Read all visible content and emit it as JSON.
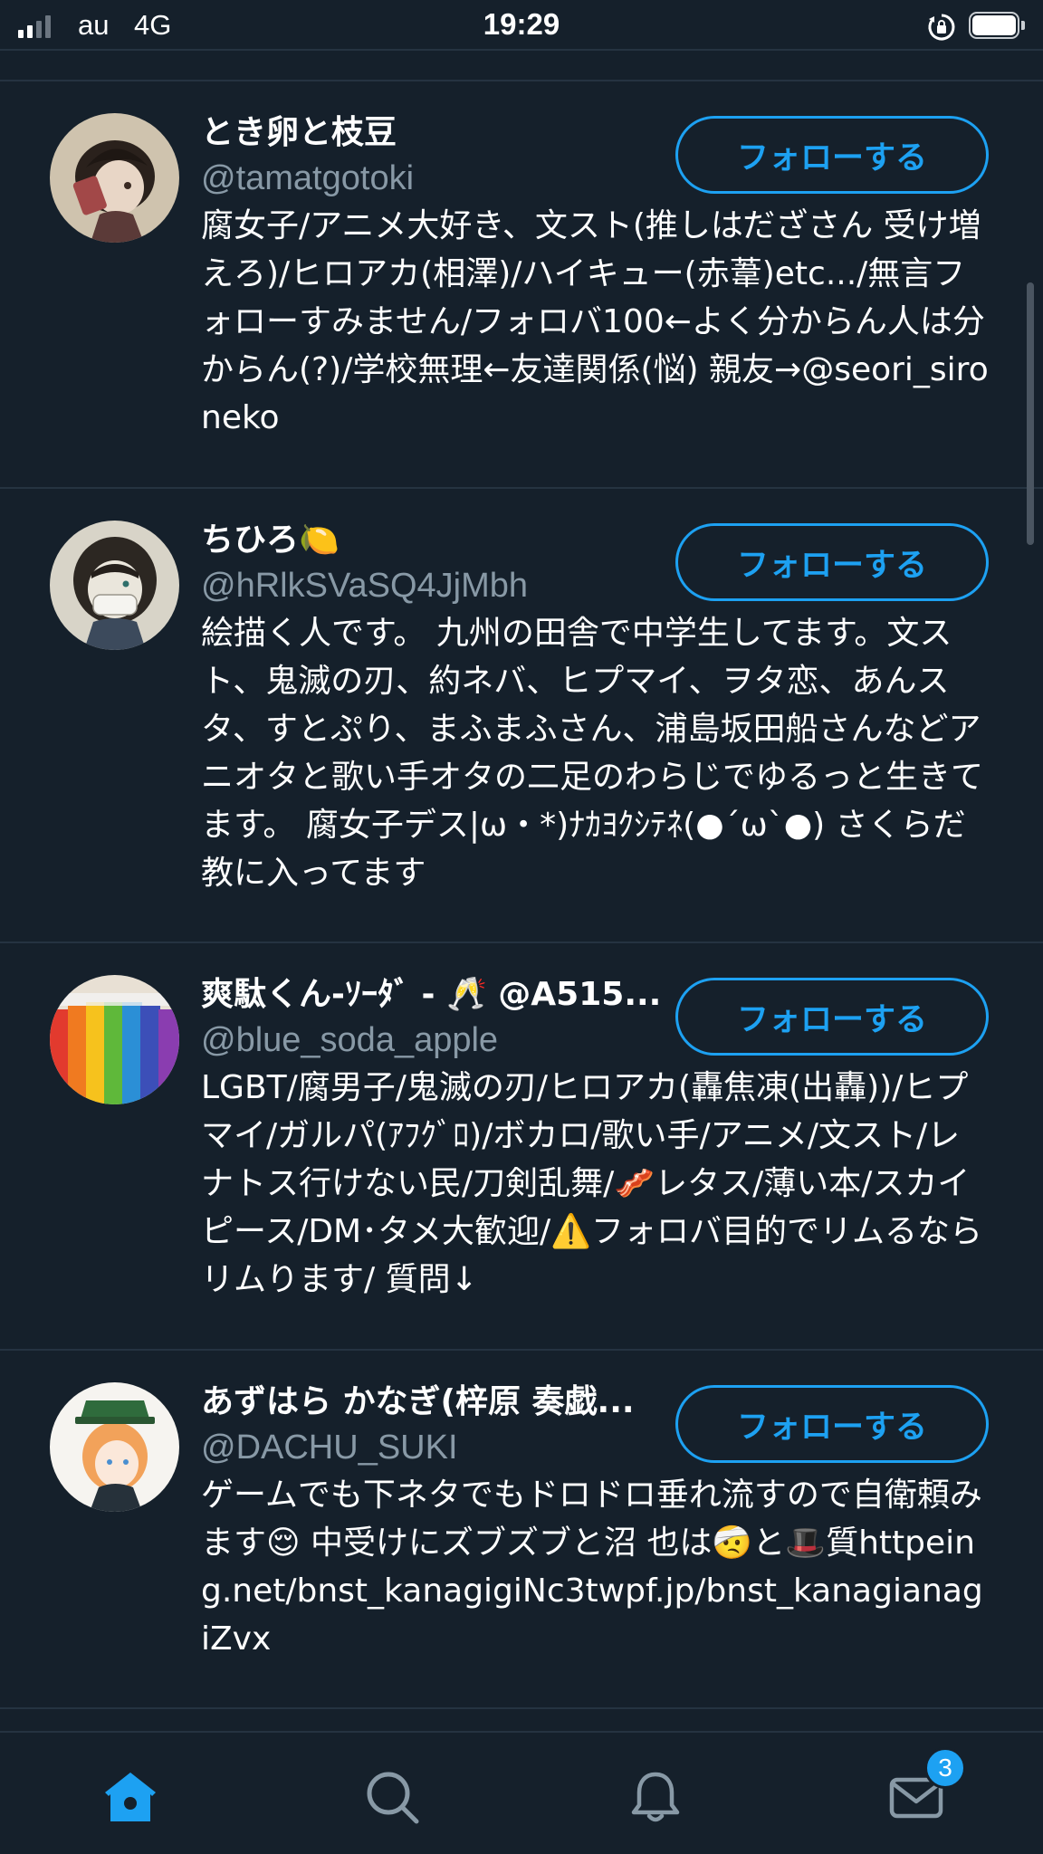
{
  "status_bar": {
    "carrier": "au",
    "network": "4G",
    "time": "19:29"
  },
  "users": [
    {
      "display_name": "とき卵と枝豆",
      "handle": "@tamatgotoki",
      "bio": "腐女子/アニメ大好き、文スト(推しはだざさん 受け増えろ)/ヒロアカ(相澤)/ハイキュー(赤葦)etc.../無言フォローすみません/フォロバ100←よく分からん人は分からん(?)/学校無理←友達関係(悩) 親友→@seori_sironeko",
      "follow_label": "フォローする"
    },
    {
      "display_name": "ちひろ🍋",
      "handle": "@hRlkSVaSQ4JjMbh",
      "bio": "絵描く人です。 九州の田舎で中学生してます。文スト、鬼滅の刃、約ネバ、ヒプマイ、ヲタ恋、あんスタ、すとぷり、まふまふさん、浦島坂田船さんなどアニオタと歌い手オタの二足のわらじでゆるっと生きてます。 腐女子デス|ω・*)ﾅｶﾖｸｼﾃﾈ(●´ω`●) さくらだ教に入ってます",
      "follow_label": "フォローする"
    },
    {
      "display_name": "爽駄くん-ｿｰﾀﾞ - 🥂 @A515...",
      "handle": "@blue_soda_apple",
      "bio": "LGBT/腐男子/鬼滅の刃/ヒロアカ(轟焦凍(出轟))/ヒプマイ/ガルパ(ｱﾌｸﾞﾛ)/ボカロ/歌い手/アニメ/文スト/レナトス行けない民/刀剣乱舞/🥓レタス/薄い本/スカイピース/DM･タメ大歓迎/⚠️フォロバ目的でリムるならリムります/ 質問↓",
      "follow_label": "フォローする"
    },
    {
      "display_name": "あずはら かなぎ(梓原 奏戯...",
      "handle": "@DACHU_SUKI",
      "bio": "ゲームでも下ネタでもドロドロ垂れ流すので自衛頼みます😌 中受けにズブズブと沼 也は🤕と🎩質httpeing.net/bnst_kanagigiNc3twpf.jp/bnst_kanagianagiZvx",
      "follow_label": "フォローする"
    }
  ],
  "tab_bar": {
    "items": [
      {
        "icon": "home-icon",
        "active": true
      },
      {
        "icon": "search-icon",
        "active": false
      },
      {
        "icon": "bell-icon",
        "active": false
      },
      {
        "icon": "mail-icon",
        "active": false
      }
    ],
    "messages_badge": "3"
  },
  "colors": {
    "background": "#15202b",
    "accent": "#1da1f2",
    "secondary_text": "#8899a6",
    "divider": "#253341"
  }
}
